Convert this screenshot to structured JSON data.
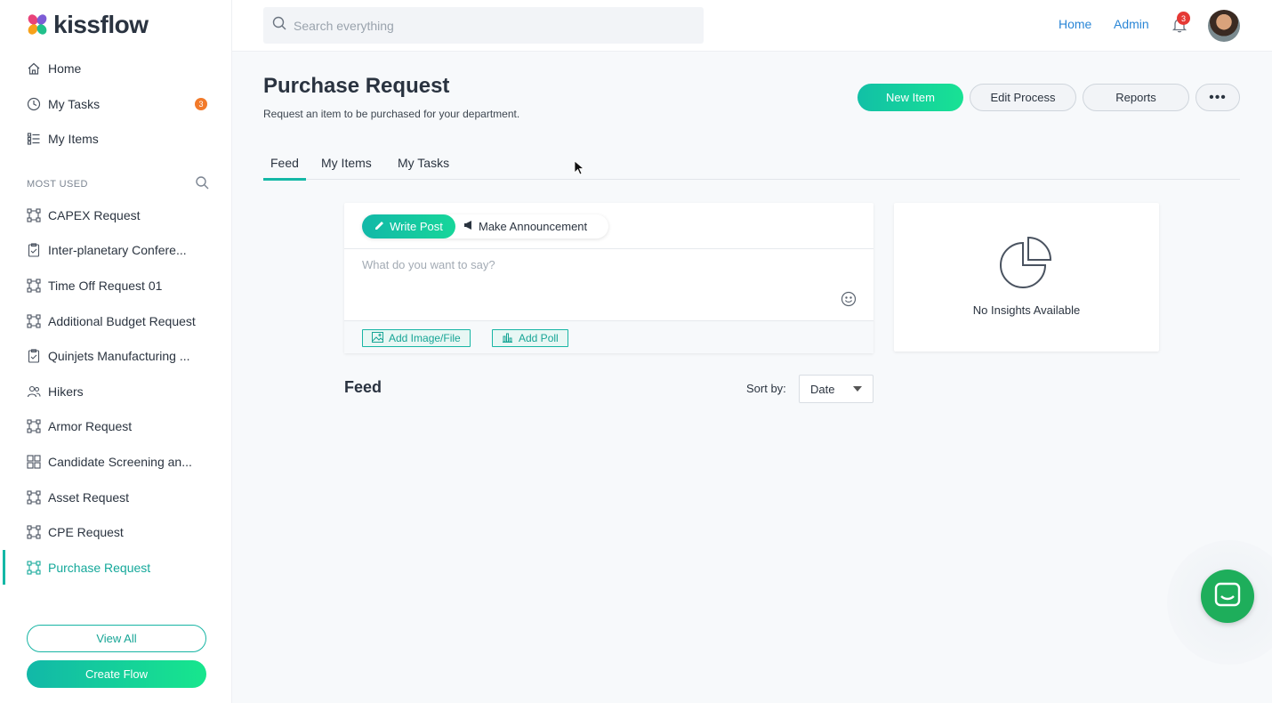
{
  "app": {
    "logo_text": "kissflow",
    "brand_colors": {
      "accent": "#14b8a6",
      "accent_gradient_end": "#17e68d",
      "link": "#2a86d6",
      "badge": "#f27a2a",
      "alert": "#e53935",
      "chat": "#1eae5b"
    }
  },
  "sidebar": {
    "nav": [
      {
        "label": "Home",
        "icon": "home-icon"
      },
      {
        "label": "My Tasks",
        "icon": "clock-icon",
        "badge": "3"
      },
      {
        "label": "My Items",
        "icon": "list-icon"
      }
    ],
    "section_title": "MOST USED",
    "flows": [
      {
        "label": "CAPEX Request",
        "icon": "process-icon"
      },
      {
        "label": "Inter-planetary Confere...",
        "icon": "clipboard-icon"
      },
      {
        "label": "Time Off Request 01",
        "icon": "process-icon"
      },
      {
        "label": "Additional Budget Request",
        "icon": "process-icon"
      },
      {
        "label": "Quinjets Manufacturing ...",
        "icon": "clipboard-icon"
      },
      {
        "label": "Hikers",
        "icon": "people-icon"
      },
      {
        "label": "Armor Request",
        "icon": "process-icon"
      },
      {
        "label": "Candidate Screening an...",
        "icon": "grid-icon"
      },
      {
        "label": "Asset Request",
        "icon": "process-icon"
      },
      {
        "label": "CPE Request",
        "icon": "process-icon"
      },
      {
        "label": "Purchase Request",
        "icon": "process-icon",
        "active": true
      }
    ],
    "view_all": "View All",
    "create_flow": "Create Flow"
  },
  "topbar": {
    "search_placeholder": "Search everything",
    "links": {
      "home": "Home",
      "admin": "Admin"
    },
    "notifications_count": "3"
  },
  "page": {
    "title": "Purchase Request",
    "subtitle": "Request an item to be purchased for your department.",
    "buttons": {
      "new_item": "New Item",
      "edit_process": "Edit Process",
      "reports": "Reports",
      "more": "•••"
    },
    "tabs": [
      {
        "label": "Feed",
        "active": true
      },
      {
        "label": "My Items"
      },
      {
        "label": "My Tasks"
      }
    ]
  },
  "composer": {
    "write_post": "Write Post",
    "make_announcement": "Make Announcement",
    "placeholder": "What do you want to say?",
    "add_file": "Add Image/File",
    "add_poll": "Add Poll"
  },
  "insights": {
    "empty_text": "No Insights Available"
  },
  "feed": {
    "title": "Feed",
    "sort_label": "Sort by:",
    "sort_value": "Date"
  }
}
